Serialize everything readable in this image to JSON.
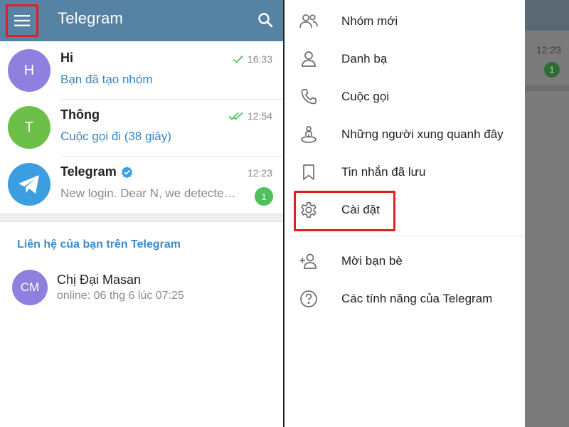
{
  "header": {
    "title": "Telegram"
  },
  "chats": [
    {
      "avatar_letter": "H",
      "avatar_color": "#8f80e0",
      "name": "Hi",
      "message": "Bạn đã tạo nhóm",
      "time": "16:33",
      "check": "single"
    },
    {
      "avatar_letter": "T",
      "avatar_color": "#6cc04a",
      "name": "Thông",
      "message": "Cuộc gọi đi (38 giây)",
      "time": "12:54",
      "check": "double"
    },
    {
      "avatar_icon": "telegram-plane-icon",
      "avatar_color": "#3a9ee0",
      "name": "Telegram",
      "message": "New login. Dear N, we detecte…",
      "time": "12:23",
      "badge": "1",
      "verified": true
    }
  ],
  "contacts": {
    "header": "Liên hệ của bạn trên Telegram",
    "items": [
      {
        "initials": "CM",
        "name": "Chị Đại Masan",
        "status": "online: 06 thg 6 lúc 07:25"
      }
    ]
  },
  "drawer": {
    "items": [
      {
        "icon": "group-icon",
        "label": "Nhóm mới"
      },
      {
        "icon": "person-icon",
        "label": "Danh bạ"
      },
      {
        "icon": "phone-icon",
        "label": "Cuộc gọi"
      },
      {
        "icon": "people-nearby-icon",
        "label": "Những người xung quanh đây"
      },
      {
        "icon": "bookmark-icon",
        "label": "Tin nhắn đã lưu"
      },
      {
        "icon": "gear-icon",
        "label": "Cài đặt"
      },
      {
        "icon": "add-person-icon",
        "label": "Mời bạn bè"
      },
      {
        "icon": "help-icon",
        "label": "Các tính năng của Telegram"
      }
    ]
  },
  "background": {
    "time": "12:23",
    "badge": "1"
  },
  "colors": {
    "header": "#5682a3",
    "accent": "#3a85c2",
    "highlight": "#e0201f",
    "badge": "#4ec15e"
  }
}
